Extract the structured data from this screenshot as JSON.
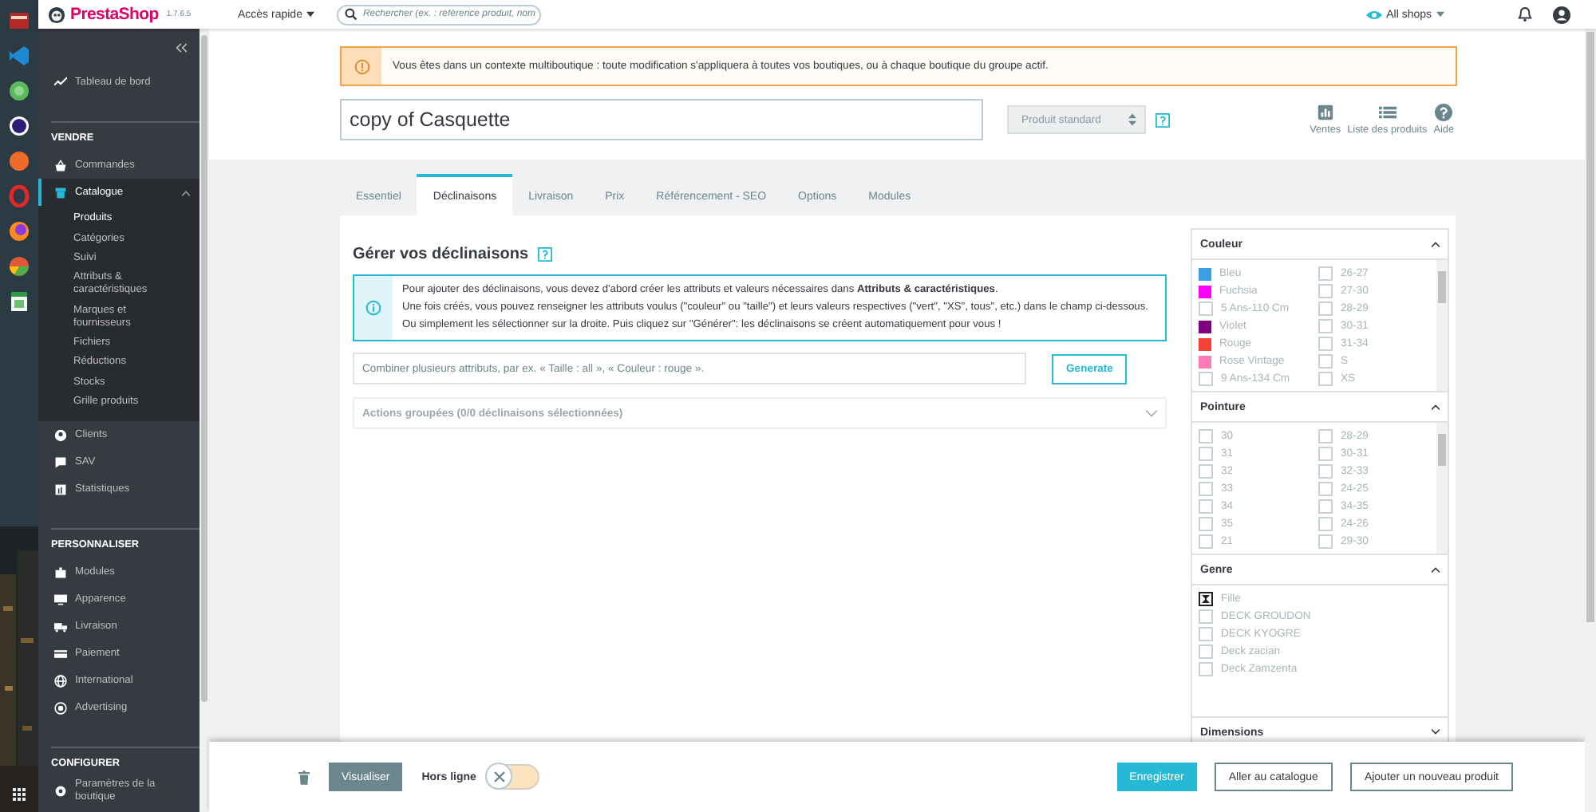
{
  "header": {
    "logo": "PrestaShop",
    "version": "1.7.6.5",
    "quick_access": "Accès rapide",
    "search_placeholder": "Rechercher (ex. : référence produit, nom",
    "shop": "All shops"
  },
  "sidebar": {
    "top_items": [
      {
        "label": "Tableau de bord",
        "selected": false
      }
    ],
    "sections": [
      {
        "title": "VENDRE",
        "items": [
          {
            "label": "Commandes",
            "selected": false
          },
          {
            "label": "Catalogue",
            "selected": true,
            "expanded": true,
            "children": [
              {
                "label": "Produits",
                "selected": true
              },
              {
                "label": "Catégories",
                "selected": false
              },
              {
                "label": "Suivi",
                "selected": false
              },
              {
                "label": "Attributs & caractéristiques",
                "selected": false
              },
              {
                "label": "Marques et fournisseurs",
                "selected": false
              },
              {
                "label": "Fichiers",
                "selected": false
              },
              {
                "label": "Réductions",
                "selected": false
              },
              {
                "label": "Stocks",
                "selected": false
              },
              {
                "label": "Grille produits",
                "selected": false
              }
            ]
          },
          {
            "label": "Clients",
            "selected": false
          },
          {
            "label": "SAV",
            "selected": false
          },
          {
            "label": "Statistiques",
            "selected": false
          }
        ]
      },
      {
        "title": "PERSONNALISER",
        "items": [
          {
            "label": "Modules",
            "selected": false
          },
          {
            "label": "Apparence",
            "selected": false
          },
          {
            "label": "Livraison",
            "selected": false
          },
          {
            "label": "Paiement",
            "selected": false
          },
          {
            "label": "International",
            "selected": false
          },
          {
            "label": "Advertising",
            "selected": false
          }
        ]
      },
      {
        "title": "CONFIGURER",
        "items": [
          {
            "label": "Paramètres de la boutique",
            "selected": false
          }
        ]
      }
    ]
  },
  "alert": "Vous êtes dans un contexte multiboutique : toute modification s'appliquera à toutes vos boutiques, ou à chaque boutique du groupe actif.",
  "product": {
    "name": "copy of Casquette",
    "type": "Produit standard",
    "toolbar": [
      "Ventes",
      "Liste des produits",
      "Aide"
    ]
  },
  "tabs": [
    {
      "label": "Essentiel",
      "selected": false
    },
    {
      "label": "Déclinaisons",
      "selected": true
    },
    {
      "label": "Livraison",
      "selected": false
    },
    {
      "label": "Prix",
      "selected": false
    },
    {
      "label": "Référencement - SEO",
      "selected": false
    },
    {
      "label": "Options",
      "selected": false
    },
    {
      "label": "Modules",
      "selected": false
    }
  ],
  "combinations": {
    "title": "Gérer vos déclinaisons",
    "info": [
      "Pour ajouter des déclinaisons, vous devez d'abord créer les attributs et valeurs nécessaires dans **Attributs & caractéristiques**.",
      "Une fois créés, vous pouvez renseigner les attributs voulus (\"couleur\" ou \"taille\") et leurs valeurs respectives (\"vert\", \"XS\", tous\", etc.) dans le champ ci-dessous. Ou simplement les sélectionner sur la droite. Puis cliquez sur \"Générer\": les déclinaisons se créent automatiquement pour vous !"
    ],
    "placeholder": "Combiner plusieurs attributs, par ex. « Taille : all », « Couleur : rouge ».",
    "generate": "Generate",
    "bulk_actions": "Actions groupées (0/0 déclinaisons sélectionnées)"
  },
  "attributes": [
    {
      "title": "Couleur",
      "expanded": true,
      "values": [
        {
          "label": "Bleu",
          "kind": "color",
          "color": "#3b9fe4"
        },
        {
          "label": "26-27",
          "kind": "checkbox",
          "checked": false
        },
        {
          "label": "Fuchsia",
          "kind": "color",
          "color": "#ff00ff"
        },
        {
          "label": "27-30",
          "kind": "checkbox",
          "checked": false
        },
        {
          "label": "5 Ans-110 Cm",
          "kind": "checkbox",
          "checked": false
        },
        {
          "label": "28-29",
          "kind": "checkbox",
          "checked": false
        },
        {
          "label": "Violet",
          "kind": "color",
          "color": "#800080"
        },
        {
          "label": "30-31",
          "kind": "checkbox",
          "checked": false
        },
        {
          "label": "Rouge",
          "kind": "color",
          "color": "#f44336"
        },
        {
          "label": "31-34",
          "kind": "checkbox",
          "checked": false
        },
        {
          "label": "Rose Vintage",
          "kind": "color",
          "color": "#ff7ab8"
        },
        {
          "label": "S",
          "kind": "checkbox",
          "checked": false
        },
        {
          "label": "9 Ans-134 Cm",
          "kind": "checkbox",
          "checked": false
        },
        {
          "label": "XS",
          "kind": "checkbox",
          "checked": false
        }
      ]
    },
    {
      "title": "Pointure",
      "expanded": true,
      "values": [
        {
          "label": "30",
          "kind": "checkbox",
          "checked": false
        },
        {
          "label": "28-29",
          "kind": "checkbox",
          "checked": false
        },
        {
          "label": "31",
          "kind": "checkbox",
          "checked": false
        },
        {
          "label": "30-31",
          "kind": "checkbox",
          "checked": false
        },
        {
          "label": "32",
          "kind": "checkbox",
          "checked": false
        },
        {
          "label": "32-33",
          "kind": "checkbox",
          "checked": false
        },
        {
          "label": "33",
          "kind": "checkbox",
          "checked": false
        },
        {
          "label": "24-25",
          "kind": "checkbox",
          "checked": false
        },
        {
          "label": "34",
          "kind": "checkbox",
          "checked": false
        },
        {
          "label": "34-35",
          "kind": "checkbox",
          "checked": false
        },
        {
          "label": "35",
          "kind": "checkbox",
          "checked": false
        },
        {
          "label": "24-26",
          "kind": "checkbox",
          "checked": false
        },
        {
          "label": "21",
          "kind": "checkbox",
          "checked": false
        },
        {
          "label": "29-30",
          "kind": "checkbox",
          "checked": false
        }
      ]
    },
    {
      "title": "Genre",
      "expanded": true,
      "single": true,
      "values": [
        {
          "label": "Fille",
          "kind": "checkbox",
          "checked": true
        },
        {
          "label": "DECK GROUDON",
          "kind": "checkbox",
          "checked": false
        },
        {
          "label": "DECK KYOGRE",
          "kind": "checkbox",
          "checked": false
        },
        {
          "label": "Deck zacian",
          "kind": "checkbox",
          "checked": false
        },
        {
          "label": "Deck Zamzenta",
          "kind": "checkbox",
          "checked": false
        }
      ]
    },
    {
      "title": "Dimensions",
      "expanded": false
    }
  ],
  "footer": {
    "preview": "Visualiser",
    "offline_label": "Hors ligne",
    "offline_on": false,
    "save": "Enregistrer",
    "catalog": "Aller au catalogue",
    "add": "Ajouter un nouveau produit"
  }
}
